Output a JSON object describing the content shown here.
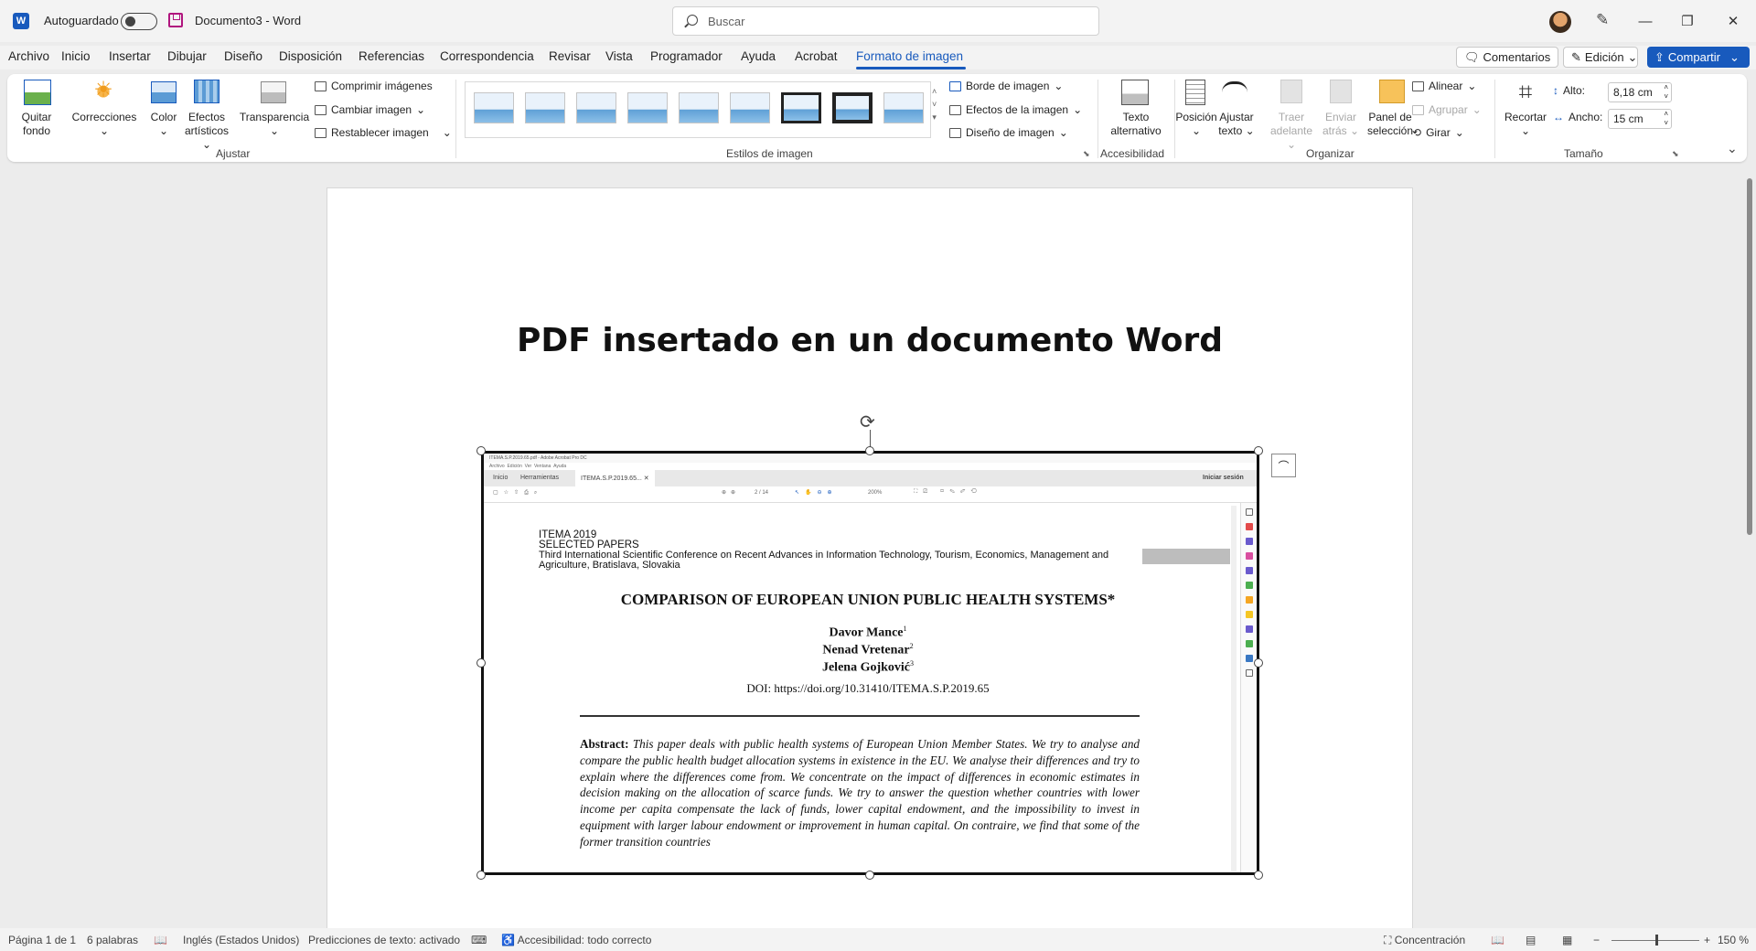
{
  "titlebar": {
    "autosave_label": "Autoguardado",
    "doc_name": "Documento3",
    "separator": "-",
    "app_name": "Word",
    "search_placeholder": "Buscar"
  },
  "menu": {
    "items": [
      "Archivo",
      "Inicio",
      "Insertar",
      "Dibujar",
      "Diseño",
      "Disposición",
      "Referencias",
      "Correspondencia",
      "Revisar",
      "Vista",
      "Programador",
      "Ayuda",
      "Acrobat",
      "Formato de imagen"
    ],
    "active": "Formato de imagen",
    "comments": "Comentarios",
    "editing": "Edición",
    "share": "Compartir"
  },
  "ribbon": {
    "ajustar": {
      "quitar_fondo": [
        "Quitar",
        "fondo"
      ],
      "correcciones": "Correcciones",
      "color": "Color",
      "efectos": [
        "Efectos",
        "artísticos"
      ],
      "transparencia": "Transparencia",
      "comprimir": "Comprimir imágenes",
      "cambiar": "Cambiar imagen",
      "restablecer": "Restablecer imagen",
      "label": "Ajustar"
    },
    "estilos": {
      "label": "Estilos de imagen",
      "borde": "Borde de imagen",
      "efectos": "Efectos de la imagen",
      "diseno": "Diseño de imagen"
    },
    "accesibilidad": {
      "texto_alt": [
        "Texto",
        "alternativo"
      ],
      "label": "Accesibilidad"
    },
    "organizar": {
      "posicion": "Posición",
      "ajustar_texto": [
        "Ajustar",
        "texto"
      ],
      "traer": [
        "Traer",
        "adelante"
      ],
      "enviar": [
        "Enviar",
        "atrás"
      ],
      "panel": [
        "Panel de",
        "selección"
      ],
      "alinear": "Alinear",
      "agrupar": "Agrupar",
      "girar": "Girar",
      "label": "Organizar"
    },
    "tamano": {
      "recortar": "Recortar",
      "alto_label": "Alto:",
      "alto_value": "8,18 cm",
      "ancho_label": "Ancho:",
      "ancho_value": "15 cm",
      "label": "Tamaño"
    }
  },
  "document": {
    "heading": "PDF insertado en un documento Word"
  },
  "pdf": {
    "window_title": "ITEMA.S.P.2019.65.pdf - Adobe Acrobat Pro DC",
    "menu": [
      "Archivo",
      "Edición",
      "Ver",
      "Ventana",
      "Ayuda"
    ],
    "tabs": [
      "Inicio",
      "Herramientas",
      "ITEMA.S.P.2019.65..."
    ],
    "signin": "Iniciar sesión",
    "page_indicator": "2 / 14",
    "zoom": "200%",
    "header_lines": [
      "ITEMA 2019",
      "SELECTED PAPERS",
      "Third International Scientific Conference on Recent Advances in Information Technology, Tourism, Economics, Management and",
      "Agriculture, Bratislava, Slovakia"
    ],
    "title": "COMPARISON OF EUROPEAN UNION PUBLIC HEALTH SYSTEMS*",
    "authors": [
      "Davor Mance",
      "Nenad Vretenar",
      "Jelena Gojković"
    ],
    "author_sups": [
      "1",
      "2",
      "3"
    ],
    "doi": "DOI: https://doi.org/10.31410/ITEMA.S.P.2019.65",
    "abstract_label": "Abstract:",
    "abstract_text": "This paper deals with public health systems of European Union Member States. We try to analyse and compare the public health budget allocation systems in existence in the EU. We analyse their differences and try to explain where the differences come from. We concentrate on the impact of differences in economic estimates in decision making on the allocation of scarce funds. We try to answer the question whether countries with lower income per capita compensate the lack of funds, lower capital endowment, and the impossibility to invest in equipment with larger labour endowment or improvement in human capital. On contraire, we find that some of the former transition countries"
  },
  "status": {
    "page": "Página 1 de 1",
    "words": "6 palabras",
    "language": "Inglés (Estados Unidos)",
    "predictions": "Predicciones de texto: activado",
    "accessibility": "Accesibilidad: todo correcto",
    "focus": "Concentración",
    "zoom": "150 %"
  }
}
